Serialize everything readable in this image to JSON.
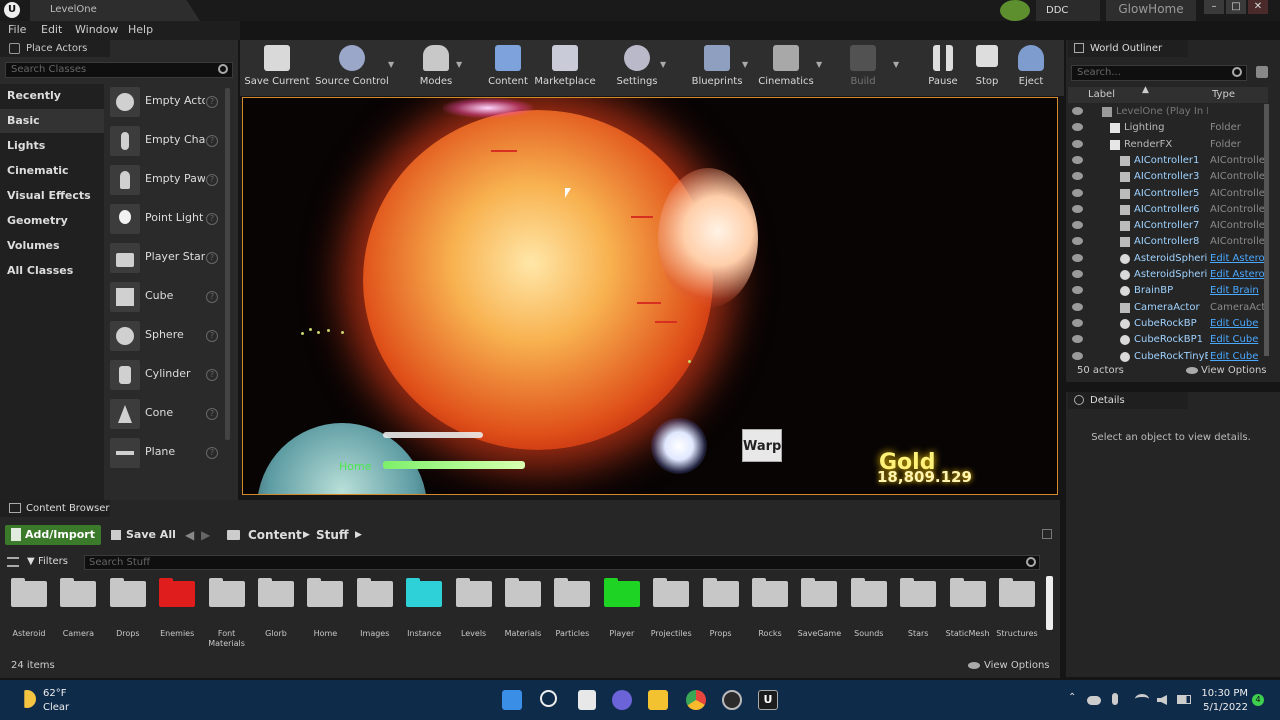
{
  "title_bar": {
    "tab": "LevelOne",
    "ddc": "DDC",
    "project": "GlowHome"
  },
  "menu": [
    "File",
    "Edit",
    "Window",
    "Help"
  ],
  "place_actors": {
    "tab": "Place Actors",
    "search_placeholder": "Search Classes",
    "categories": [
      "Recently Placed",
      "Basic",
      "Lights",
      "Cinematic",
      "Visual Effects",
      "Geometry",
      "Volumes",
      "All Classes"
    ],
    "selected_category": "Basic",
    "actors": [
      "Empty Actor",
      "Empty Character",
      "Empty Pawn",
      "Point Light",
      "Player Start",
      "Cube",
      "Sphere",
      "Cylinder",
      "Cone",
      "Plane"
    ]
  },
  "toolbar": {
    "save_current": "Save Current",
    "source_control": "Source Control",
    "modes": "Modes",
    "content": "Content",
    "marketplace": "Marketplace",
    "settings": "Settings",
    "blueprints": "Blueprints",
    "cinematics": "Cinematics",
    "build": "Build",
    "pause": "Pause",
    "stop": "Stop",
    "eject": "Eject"
  },
  "viewport": {
    "warp_label": "Warp",
    "home_label": "Home",
    "gold_label": "Gold",
    "gold_value": "18,809.129"
  },
  "world_outliner": {
    "tab": "World Outliner",
    "search_placeholder": "Search...",
    "col_label": "Label",
    "col_type": "Type",
    "rows": [
      {
        "label": "LevelOne (Play In EdWorld",
        "type": "",
        "kind": "world"
      },
      {
        "label": "Lighting",
        "type": "Folder",
        "kind": "folder"
      },
      {
        "label": "RenderFX",
        "type": "Folder",
        "kind": "folder"
      },
      {
        "label": "AIController1",
        "type": "AIController",
        "kind": "actor"
      },
      {
        "label": "AIController3",
        "type": "AIController",
        "kind": "actor"
      },
      {
        "label": "AIController5",
        "type": "AIController",
        "kind": "actor"
      },
      {
        "label": "AIController6",
        "type": "AIController",
        "kind": "actor"
      },
      {
        "label": "AIController7",
        "type": "AIController",
        "kind": "actor"
      },
      {
        "label": "AIController8",
        "type": "AIController",
        "kind": "actor"
      },
      {
        "label": "AsteroidSpherical",
        "type": "Edit Asteroid",
        "kind": "bp"
      },
      {
        "label": "AsteroidSpherical",
        "type": "Edit Asteroid",
        "kind": "bp"
      },
      {
        "label": "BrainBP",
        "type": "Edit Brain",
        "kind": "bp"
      },
      {
        "label": "CameraActor",
        "type": "CameraActor",
        "kind": "actor"
      },
      {
        "label": "CubeRockBP",
        "type": "Edit Cube",
        "kind": "bp"
      },
      {
        "label": "CubeRockBP1",
        "type": "Edit Cube",
        "kind": "bp"
      },
      {
        "label": "CubeRockTinyBP",
        "type": "Edit Cube",
        "kind": "bp"
      }
    ],
    "actor_count": "50 actors",
    "view_options": "View Options"
  },
  "details": {
    "tab": "Details",
    "empty_message": "Select an object to view details."
  },
  "content_browser": {
    "tab": "Content Browser",
    "add_import": "Add/Import",
    "save_all": "Save All",
    "path": [
      "Content",
      "Stuff"
    ],
    "filters": "Filters",
    "search_placeholder": "Search Stuff",
    "folders": [
      {
        "name": "Asteroid",
        "color": "#c7c7c7"
      },
      {
        "name": "Camera",
        "color": "#c7c7c7"
      },
      {
        "name": "Drops",
        "color": "#c7c7c7"
      },
      {
        "name": "Enemies",
        "color": "#e01d1d"
      },
      {
        "name": "Font Materials",
        "color": "#c7c7c7"
      },
      {
        "name": "Glorb",
        "color": "#c7c7c7"
      },
      {
        "name": "Home",
        "color": "#c7c7c7"
      },
      {
        "name": "Images",
        "color": "#c7c7c7"
      },
      {
        "name": "Instance",
        "color": "#2fd1d8"
      },
      {
        "name": "Levels",
        "color": "#c7c7c7"
      },
      {
        "name": "Materials",
        "color": "#c7c7c7"
      },
      {
        "name": "Particles",
        "color": "#c7c7c7"
      },
      {
        "name": "Player",
        "color": "#1ed324"
      },
      {
        "name": "Projectiles",
        "color": "#c7c7c7"
      },
      {
        "name": "Props",
        "color": "#c7c7c7"
      },
      {
        "name": "Rocks",
        "color": "#c7c7c7"
      },
      {
        "name": "SaveGame",
        "color": "#c7c7c7"
      },
      {
        "name": "Sounds",
        "color": "#c7c7c7"
      },
      {
        "name": "Stars",
        "color": "#c7c7c7"
      },
      {
        "name": "StaticMesh",
        "color": "#c7c7c7"
      },
      {
        "name": "Structures",
        "color": "#c7c7c7"
      }
    ],
    "item_count": "24 items",
    "view_options": "View Options"
  },
  "taskbar": {
    "temp": "62°F",
    "condition": "Clear",
    "time": "10:30 PM",
    "date": "5/1/2022",
    "notifications": "4"
  },
  "colors": {
    "accent_green": "#3b7a2a",
    "link_blue": "#4aa8ff",
    "outliner_text": "#9fd2ff"
  }
}
